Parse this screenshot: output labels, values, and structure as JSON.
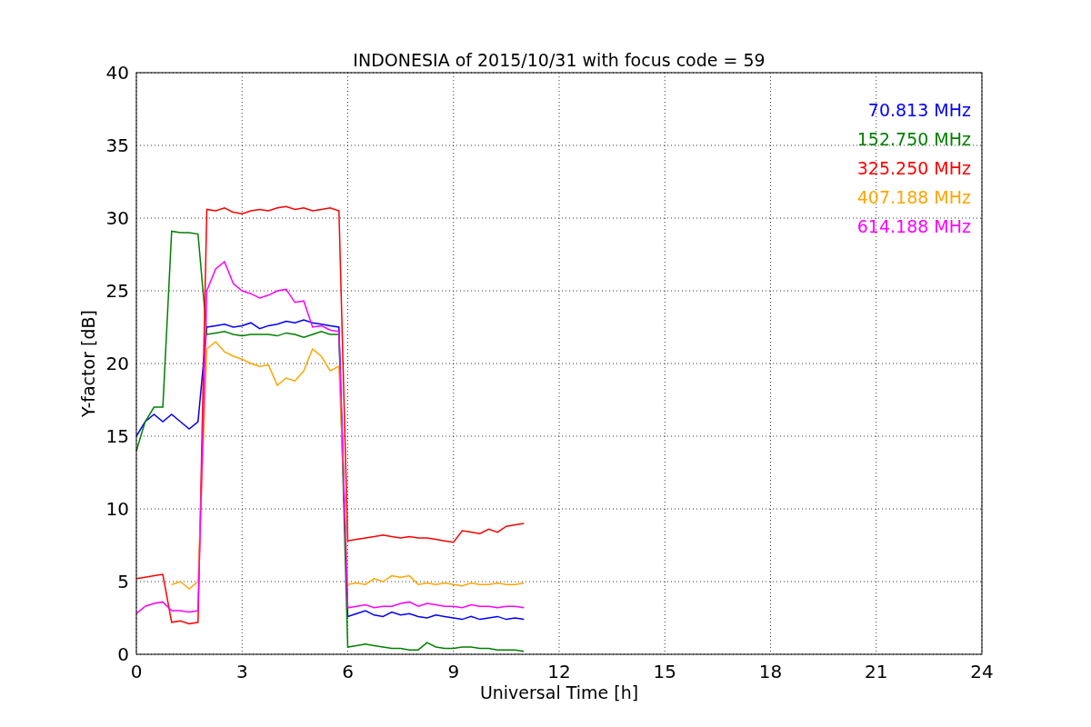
{
  "figure": {
    "chart_data": {
      "type": "line",
      "title": "INDONESIA of 2015/10/31 with focus code = 59",
      "xlabel": "Universal Time [h]",
      "ylabel": "Y-factor [dB]",
      "x": [
        0,
        0.25,
        0.5,
        0.75,
        1,
        1.25,
        1.5,
        1.75,
        2,
        2.25,
        2.5,
        2.75,
        3,
        3.25,
        3.5,
        3.75,
        4,
        4.25,
        4.5,
        4.75,
        5,
        5.25,
        5.5,
        5.75,
        6,
        6.25,
        6.5,
        6.75,
        7,
        7.25,
        7.5,
        7.75,
        8,
        8.25,
        8.5,
        8.75,
        9,
        9.25,
        9.5,
        9.75,
        10,
        10.25,
        10.5,
        10.75,
        11
      ],
      "grid": true,
      "xlim": [
        0,
        24
      ],
      "ylim": [
        0,
        40
      ],
      "xticks": [
        0,
        3,
        6,
        9,
        12,
        15,
        18,
        21,
        24
      ],
      "yticks": [
        0,
        5,
        10,
        15,
        20,
        25,
        30,
        35,
        40
      ],
      "series": [
        {
          "name": "70.813 MHz",
          "color": "#0000ff",
          "values": [
            15,
            16,
            16.5,
            16,
            16.5,
            16,
            15.5,
            16,
            22.5,
            22.6,
            22.7,
            22.5,
            22.6,
            22.8,
            22.4,
            22.6,
            22.7,
            22.9,
            22.8,
            23,
            22.8,
            22.7,
            22.6,
            22.5,
            2.6,
            2.8,
            3,
            2.7,
            2.6,
            2.9,
            2.7,
            2.8,
            2.6,
            2.5,
            2.7,
            2.6,
            2.5,
            2.4,
            2.6,
            2.4,
            2.5,
            2.6,
            2.4,
            2.5,
            2.4
          ]
        },
        {
          "name": "152.750 MHz",
          "color": "#008000",
          "values": [
            14,
            16,
            17,
            17,
            29.1,
            29,
            29,
            28.9,
            22,
            22.1,
            22.2,
            22,
            21.9,
            22,
            22,
            22,
            21.9,
            22.1,
            22,
            21.8,
            22,
            22.2,
            22,
            22,
            0.5,
            0.6,
            0.7,
            0.6,
            0.5,
            0.4,
            0.4,
            0.3,
            0.3,
            0.8,
            0.5,
            0.4,
            0.4,
            0.5,
            0.5,
            0.4,
            0.4,
            0.3,
            0.3,
            0.3,
            0.2
          ]
        },
        {
          "name": "325.250 MHz",
          "color": "#ff0000",
          "values": [
            5.2,
            5.3,
            5.4,
            5.5,
            2.2,
            2.3,
            2.1,
            2.2,
            30.6,
            30.5,
            30.7,
            30.4,
            30.3,
            30.5,
            30.6,
            30.5,
            30.7,
            30.8,
            30.6,
            30.7,
            30.5,
            30.6,
            30.7,
            30.5,
            7.8,
            7.9,
            8,
            8.1,
            8.2,
            8.1,
            8,
            8.1,
            8,
            8,
            7.9,
            7.8,
            7.7,
            8.5,
            8.4,
            8.3,
            8.6,
            8.4,
            8.8,
            8.9,
            9
          ]
        },
        {
          "name": "407.188 MHz",
          "color": "#ffa500",
          "values": [
            null,
            null,
            null,
            null,
            4.8,
            5,
            4.5,
            5,
            21,
            21.5,
            20.8,
            20.5,
            20.3,
            20,
            19.8,
            19.9,
            18.5,
            19,
            18.8,
            19.5,
            21,
            20.5,
            19.5,
            19.8,
            4.8,
            4.9,
            4.8,
            5.2,
            5,
            5.4,
            5.3,
            5.4,
            4.8,
            4.9,
            4.8,
            4.9,
            4.8,
            4.7,
            4.9,
            4.8,
            4.8,
            4.9,
            4.8,
            4.8,
            4.9
          ]
        },
        {
          "name": "614.188 MHz",
          "color": "#ff00ff",
          "values": [
            2.8,
            3.3,
            3.5,
            3.6,
            3,
            3,
            2.9,
            3,
            25,
            26.5,
            27,
            25.5,
            25,
            24.8,
            24.5,
            24.7,
            25,
            25.1,
            24.2,
            24.3,
            22.5,
            22.6,
            22.3,
            22.2,
            3.2,
            3.3,
            3.4,
            3.2,
            3.3,
            3.3,
            3.5,
            3.6,
            3.3,
            3.5,
            3.4,
            3.3,
            3.3,
            3.2,
            3.4,
            3.3,
            3.3,
            3.2,
            3.3,
            3.3,
            3.2
          ]
        }
      ]
    }
  }
}
